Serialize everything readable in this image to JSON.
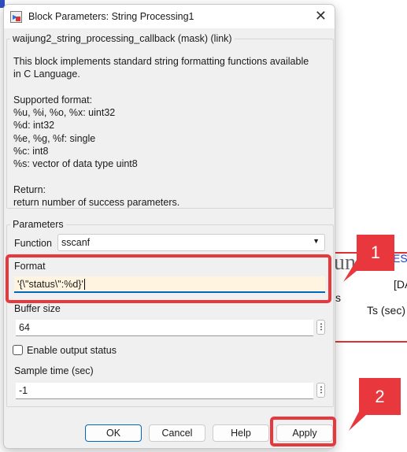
{
  "background": {
    "text1": "un",
    "text2": "ES",
    "text3": "[DA",
    "text4": "Ts (sec)",
    "text5": "s"
  },
  "dialog": {
    "title": "Block Parameters: String Processing1",
    "mask_group": {
      "legend": "waijung2_string_processing_callback (mask) (link)",
      "description": "This block implements standard string formatting functions available\nin C Language.\n\nSupported format:\n%u, %i, %o, %x: uint32\n%d: int32\n%e, %g, %f: single\n%c: int8\n%s: vector of data type uint8\n\nReturn:\nreturn number of success parameters."
    },
    "parameters": {
      "legend": "Parameters",
      "function_label": "Function",
      "function_value": "sscanf",
      "format_label": "Format",
      "format_value": "'{\\\"status\\\":%d}'",
      "buffer_label": "Buffer size",
      "buffer_value": "64",
      "enable_status_label": "Enable output status",
      "enable_status_checked": false,
      "sample_time_label": "Sample time (sec)",
      "sample_time_value": "-1"
    },
    "buttons": {
      "ok": "OK",
      "cancel": "Cancel",
      "help": "Help",
      "apply": "Apply"
    }
  },
  "callouts": [
    "1",
    "2"
  ],
  "colors": {
    "highlight": "#e8383d",
    "focus": "#0067c0"
  }
}
